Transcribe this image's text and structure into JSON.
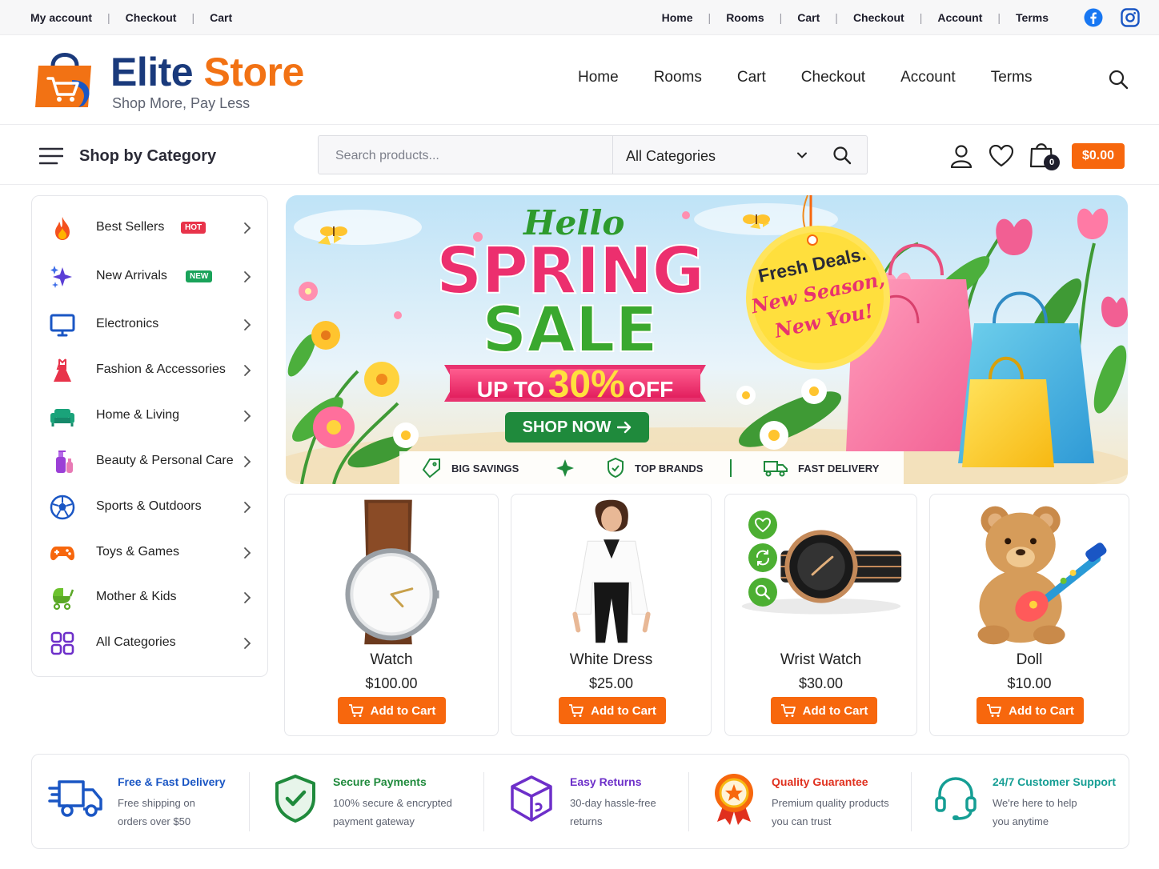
{
  "topbar": {
    "left_links": [
      "My account",
      "Checkout",
      "Cart"
    ],
    "right_links": [
      "Home",
      "Rooms",
      "Cart",
      "Checkout",
      "Account",
      "Terms"
    ],
    "social": [
      "facebook-icon",
      "instagram-icon"
    ]
  },
  "header": {
    "brand_first": "Elite",
    "brand_second": "Store",
    "tagline": "Shop More, Pay Less",
    "nav": [
      "Home",
      "Rooms",
      "Cart",
      "Checkout",
      "Account",
      "Terms"
    ]
  },
  "shopbar": {
    "menu_label": "Shop by Category",
    "search_placeholder": "Search products...",
    "category_select": "All Categories",
    "cart_count": "0",
    "cart_total": "$0.00"
  },
  "sidebar": {
    "items": [
      {
        "label": "Best Sellers",
        "badge": "HOT",
        "icon": "fire-icon"
      },
      {
        "label": "New Arrivals",
        "badge": "NEW",
        "icon": "sparkle-icon"
      },
      {
        "label": "Electronics",
        "badge": "",
        "icon": "monitor-icon"
      },
      {
        "label": "Fashion & Accessories",
        "badge": "",
        "icon": "dress-icon"
      },
      {
        "label": "Home & Living",
        "badge": "",
        "icon": "sofa-icon"
      },
      {
        "label": "Beauty & Personal Care",
        "badge": "",
        "icon": "cosmetics-icon"
      },
      {
        "label": "Sports & Outdoors",
        "badge": "",
        "icon": "soccer-ball-icon"
      },
      {
        "label": "Toys & Games",
        "badge": "",
        "icon": "gamepad-icon"
      },
      {
        "label": "Mother & Kids",
        "badge": "",
        "icon": "stroller-icon"
      },
      {
        "label": "All Categories",
        "badge": "",
        "icon": "grid-icon"
      }
    ]
  },
  "hero": {
    "hello": "Hello",
    "spring": "SPRING",
    "sale": "SALE",
    "up_to": "UP TO",
    "percent": "30%",
    "off": "OFF",
    "cta": "SHOP NOW",
    "tag_line1": "Fresh Deals.",
    "tag_line2": "New Season,",
    "tag_line3": "New You!",
    "perks": [
      "BIG SAVINGS",
      "TOP BRANDS",
      "FAST DELIVERY"
    ]
  },
  "products": [
    {
      "name": "Watch",
      "price": "$100.00",
      "button": "Add to Cart"
    },
    {
      "name": "White Dress",
      "price": "$25.00",
      "button": "Add to Cart"
    },
    {
      "name": "Wrist Watch",
      "price": "$30.00",
      "button": "Add to Cart"
    },
    {
      "name": "Doll",
      "price": "$10.00",
      "button": "Add to Cart"
    }
  ],
  "features": [
    {
      "title": "Free & Fast Delivery",
      "line1": "Free shipping on",
      "line2": "orders over $50",
      "color": "#1a56c4",
      "icon": "truck-icon"
    },
    {
      "title": "Secure Payments",
      "line1": "100% secure & encrypted",
      "line2": "payment gateway",
      "color": "#1f8a3c",
      "icon": "shield-check-icon"
    },
    {
      "title": "Easy Returns",
      "line1": "30-day hassle-free",
      "line2": "returns",
      "color": "#6d2fc9",
      "icon": "box-return-icon"
    },
    {
      "title": "Quality Guarantee",
      "line1": "Premium quality products",
      "line2": "you can trust",
      "color": "#e0301e",
      "icon": "award-icon"
    },
    {
      "title": "24/7 Customer Support",
      "line1": "We're here to help",
      "line2": "you anytime",
      "color": "#159e94",
      "icon": "headset-icon"
    }
  ],
  "colors": {
    "accent": "#f7670d",
    "brand_blue": "#1a3a7c",
    "brand_orange": "#f27214",
    "sale_pink": "#e8336f",
    "sale_green": "#2e9b2e"
  }
}
